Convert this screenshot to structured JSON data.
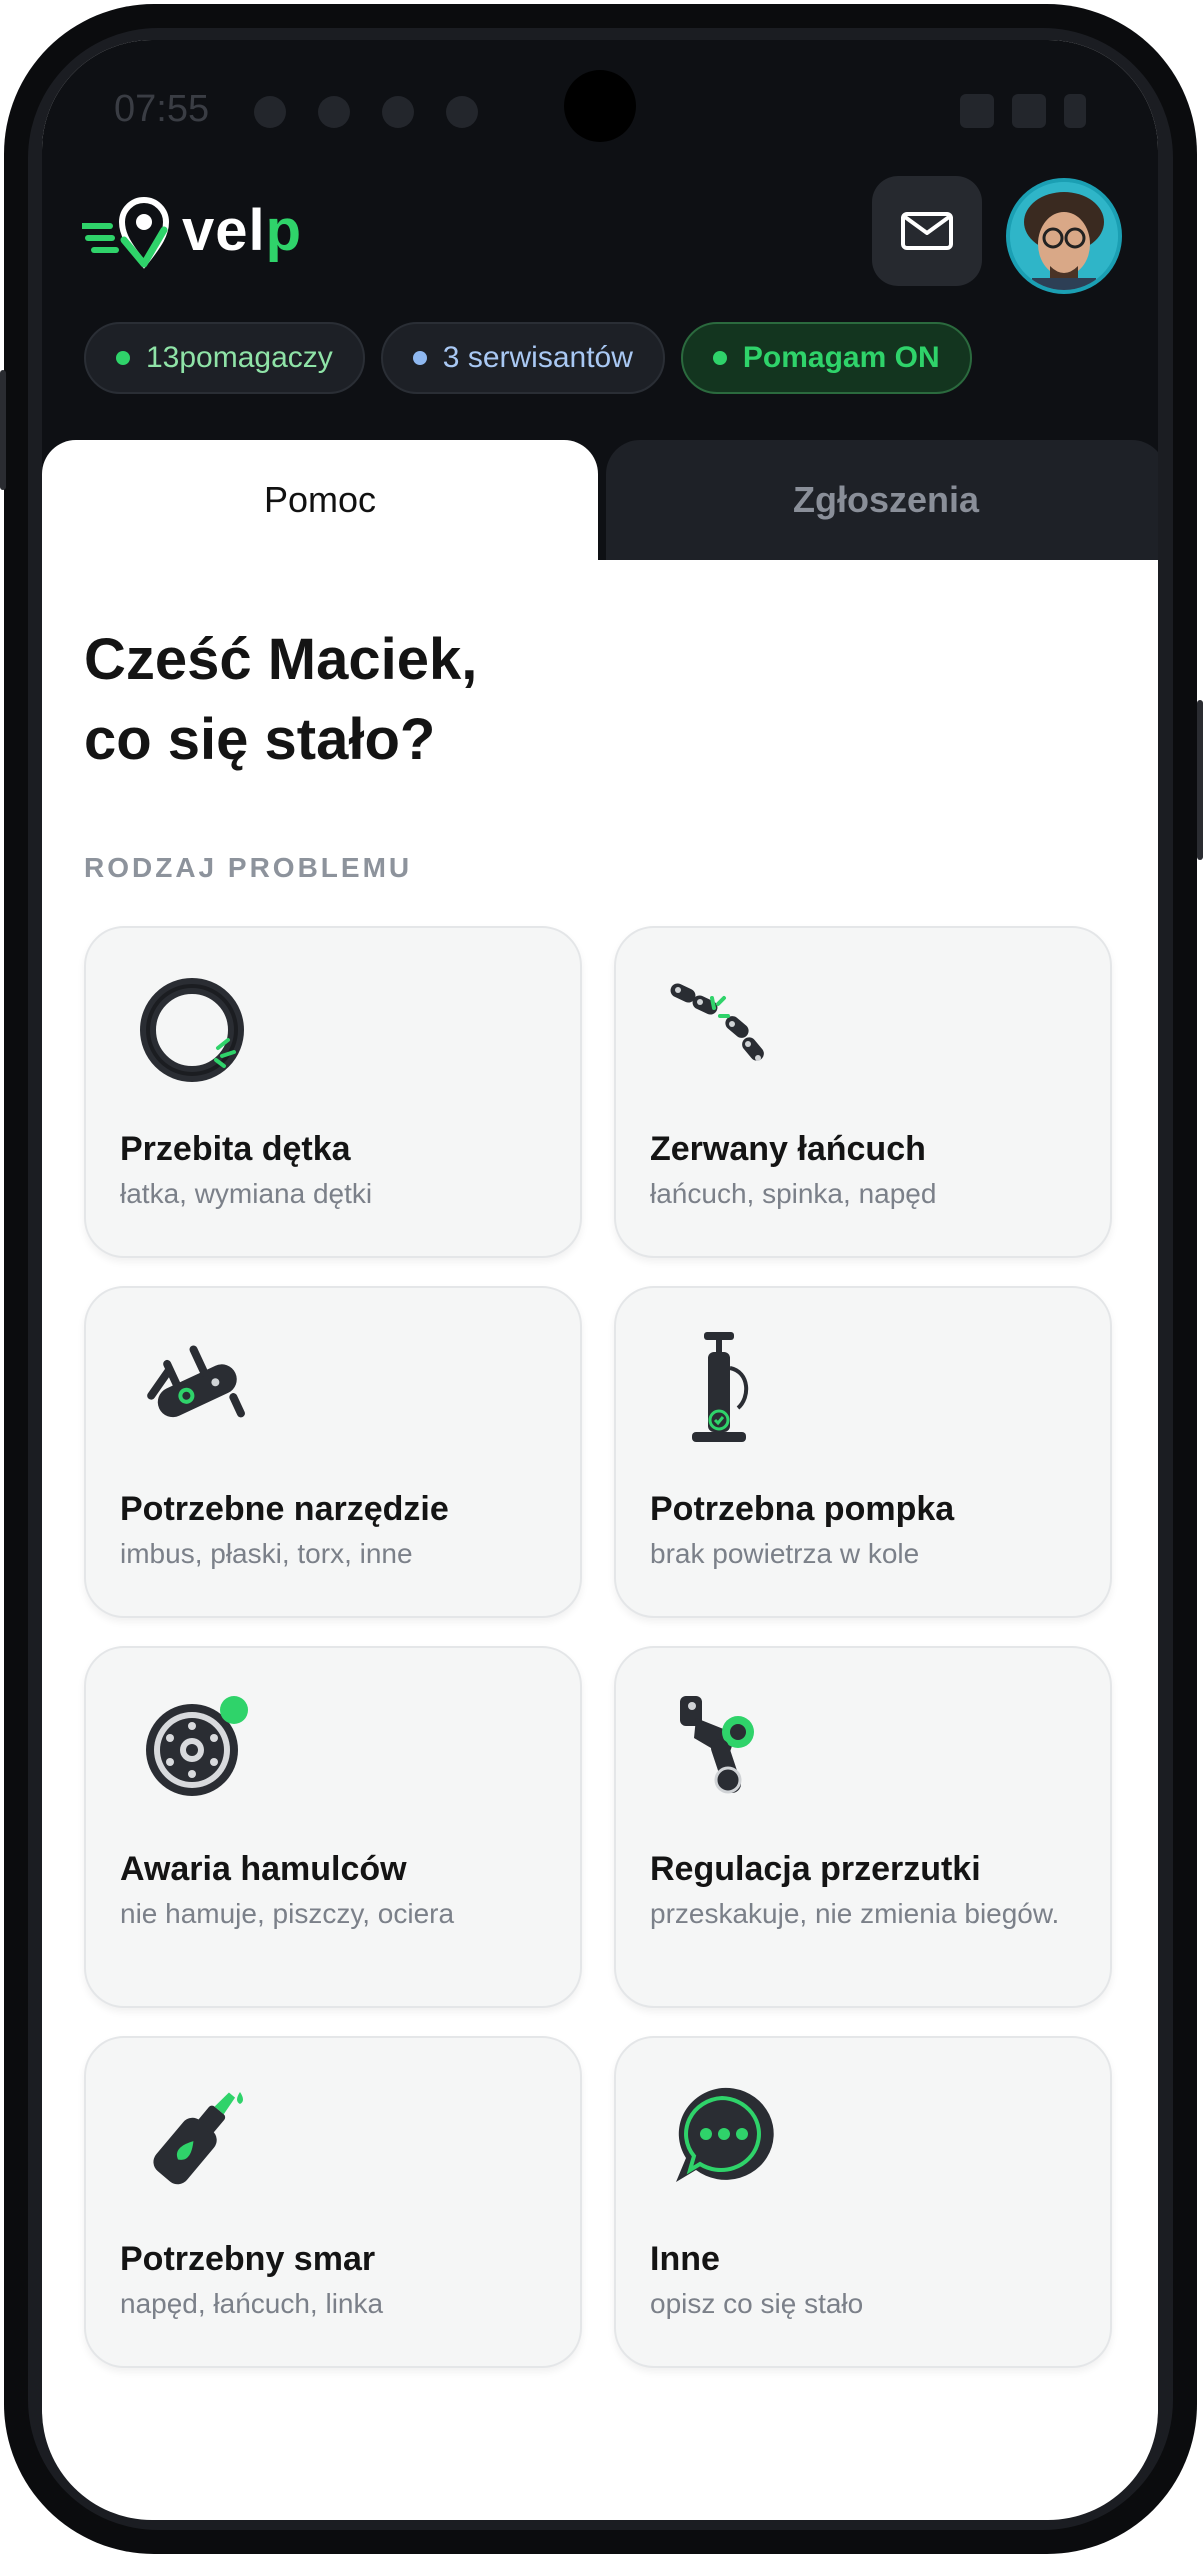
{
  "status_bar": {
    "time": "07:55"
  },
  "brand": {
    "name_prefix": "vel",
    "name_suffix": "p"
  },
  "header": {
    "mail_icon": "mail-icon",
    "chips": [
      {
        "count": "13",
        "label": "pomagaczy",
        "color": "#2fd36a"
      },
      {
        "count": "3",
        "label": "serwisantów",
        "color": "#8fb8f0"
      },
      {
        "label": "Pomagam ON",
        "color": "#2fd36a"
      }
    ]
  },
  "tabs": [
    {
      "label": "Pomoc",
      "active": true
    },
    {
      "label": "Zgłoszenia",
      "active": false
    }
  ],
  "greeting": {
    "line1": "Cześć Maciek,",
    "line2": "co się stało?"
  },
  "section_label": "RODZAJ PROBLEMU",
  "problems": [
    {
      "title": "Przebita dętka",
      "subtitle": "łatka, wymiana dętki",
      "icon": "inner-tube-icon"
    },
    {
      "title": "Zerwany łańcuch",
      "subtitle": "łańcuch, spinka, napęd",
      "icon": "chain-icon"
    },
    {
      "title": "Potrzebne narzędzie",
      "subtitle": "imbus, płaski, torx, inne",
      "icon": "multitool-icon"
    },
    {
      "title": "Potrzebna pompka",
      "subtitle": "brak powietrza w kole",
      "icon": "pump-icon"
    },
    {
      "title": "Awaria hamulców",
      "subtitle": "nie hamuje, piszczy, ociera",
      "icon": "brake-disc-icon"
    },
    {
      "title": "Regulacja przerzutki",
      "subtitle": "przeskakuje, nie zmienia biegów.",
      "icon": "derailleur-icon"
    },
    {
      "title": "Potrzebny smar",
      "subtitle": "napęd, łańcuch, linka",
      "icon": "lube-bottle-icon"
    },
    {
      "title": "Inne",
      "subtitle": "opisz co się stało",
      "icon": "chat-bubble-icon"
    }
  ],
  "colors": {
    "accent": "#2fd36a",
    "dark_bg": "#0e1014",
    "card_bg": "#f5f6f6"
  }
}
